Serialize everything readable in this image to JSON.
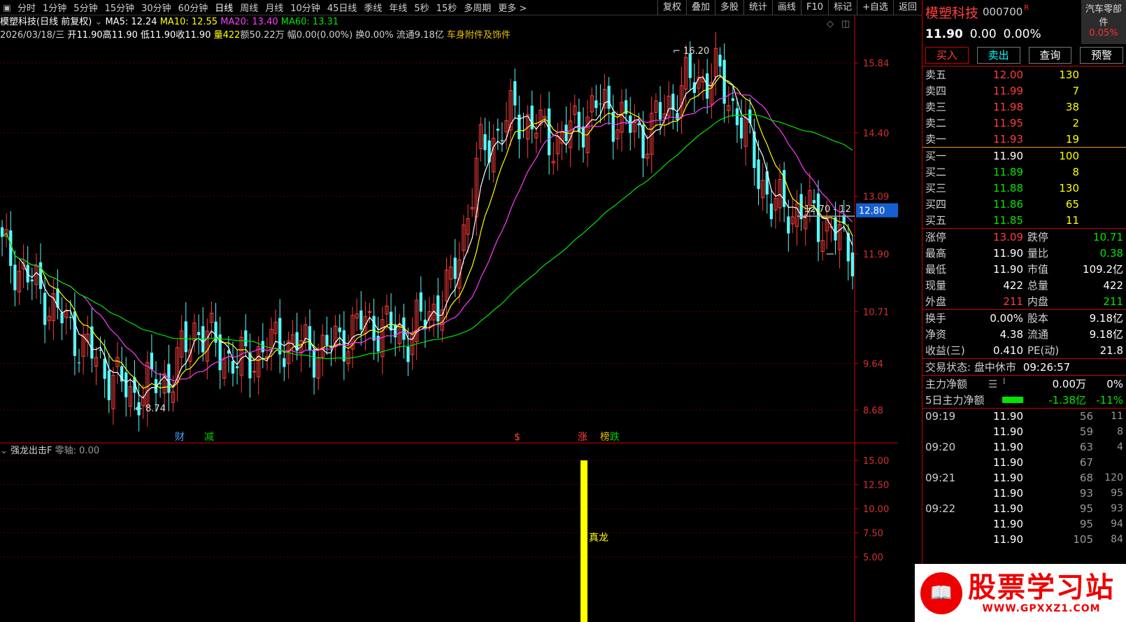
{
  "toolbar": {
    "periods": [
      "分时",
      "1分钟",
      "5分钟",
      "15分钟",
      "30分钟",
      "60分钟",
      "日线",
      "周线",
      "月线",
      "10分钟",
      "45日线",
      "季线",
      "年线",
      "5秒",
      "15秒",
      "多周期",
      "更多 >"
    ],
    "active_period": "日线",
    "buttons": [
      "复权",
      "叠加",
      "多股",
      "统计",
      "画线",
      "F10",
      "标记",
      "+自选",
      "返回"
    ]
  },
  "chart_header": {
    "title": "模塑科技(日线 前复权)",
    "ma5": "MA5: 12.24",
    "ma10": "MA10: 12.55",
    "ma20": "MA20: 13.40",
    "ma60": "MA60: 13.31",
    "date": "2026/03/18/三",
    "open": "开11.90",
    "high": "高11.90",
    "low": "低11.90",
    "close": "收11.90",
    "volume": "量422",
    "amount": "额50.22万",
    "change": "幅0.00(0.00%)",
    "turnover": "换0.00%",
    "float": "流通9.18亿",
    "concept": "车身附件及饰件"
  },
  "price_axis": [
    "15.84",
    "14.40",
    "13.09",
    "12.80",
    "11.90",
    "10.71",
    "9.64",
    "8.68"
  ],
  "annotations": {
    "high_marker": "16.20",
    "low_marker": "8.74",
    "line_label": "12.70 - 12",
    "current_price_tag": "12.80"
  },
  "event_tags": [
    "财",
    "减",
    "$",
    "涨",
    "榜",
    "跌"
  ],
  "indicator": {
    "name": "强龙出击F",
    "zero_axis": "零轴: 0.00",
    "axis": [
      "15.00",
      "12.50",
      "10.00",
      "7.50",
      "5.00"
    ],
    "signal_label": "真龙",
    "signal_value": 15
  },
  "colors": {
    "up": "#ff3c3c",
    "down": "#54ffff",
    "ma5": "#ffffff",
    "ma10": "#ffff00",
    "ma20": "#ff3cff",
    "ma60": "#00e600"
  },
  "quote": {
    "name": "模塑科技",
    "code": "000700",
    "r_flag": "R",
    "sector": "汽车零部件",
    "sector_change": "0.05%",
    "price": "11.90",
    "change": "0.00",
    "change_pct": "0.00%",
    "actions": [
      "买入",
      "卖出",
      "查询",
      "预警"
    ]
  },
  "order_book": {
    "asks": [
      {
        "label": "卖五",
        "price": "12.00",
        "vol": "130"
      },
      {
        "label": "卖四",
        "price": "11.99",
        "vol": "7"
      },
      {
        "label": "卖三",
        "price": "11.98",
        "vol": "38"
      },
      {
        "label": "卖二",
        "price": "11.95",
        "vol": "2"
      },
      {
        "label": "卖一",
        "price": "11.93",
        "vol": "19"
      }
    ],
    "bids": [
      {
        "label": "买一",
        "price": "11.90",
        "vol": "100"
      },
      {
        "label": "买二",
        "price": "11.89",
        "vol": "8"
      },
      {
        "label": "买三",
        "price": "11.88",
        "vol": "130"
      },
      {
        "label": "买四",
        "price": "11.86",
        "vol": "65"
      },
      {
        "label": "买五",
        "price": "11.85",
        "vol": "11"
      }
    ]
  },
  "stats": [
    {
      "l": "涨停",
      "v": "13.09",
      "l2": "跌停",
      "v2": "10.71"
    },
    {
      "l": "最高",
      "v": "11.90",
      "l2": "量比",
      "v2": "0.38"
    },
    {
      "l": "最低",
      "v": "11.90",
      "l2": "市值",
      "v2": "109.2亿"
    },
    {
      "l": "现量",
      "v": "422",
      "l2": "总量",
      "v2": "422"
    },
    {
      "l": "外盘",
      "v": "211",
      "l2": "内盘",
      "v2": "211"
    }
  ],
  "stats2": [
    {
      "l": "换手",
      "v": "0.00%",
      "l2": "股本",
      "v2": "9.18亿"
    },
    {
      "l": "净资",
      "v": "4.38",
      "l2": "流通",
      "v2": "9.18亿"
    },
    {
      "l": "收益(三)",
      "v": "0.410",
      "l2": "PE(动)",
      "v2": "21.8"
    }
  ],
  "trade_status": {
    "label": "交易状态: 盘中休市",
    "time": "09:26:57"
  },
  "fund_flow": [
    {
      "label": "主力净额",
      "value": "0.00万",
      "pct": "0%"
    },
    {
      "label": "5日主力净额",
      "value": "-1.38亿",
      "pct": "-11%"
    }
  ],
  "ticks": [
    {
      "t": "09:19",
      "p": "11.90",
      "v": "56",
      "n": "11"
    },
    {
      "t": "",
      "p": "11.90",
      "v": "59",
      "n": "8"
    },
    {
      "t": "09:20",
      "p": "11.90",
      "v": "63",
      "n": "4"
    },
    {
      "t": "",
      "p": "11.90",
      "v": "67",
      "n": ""
    },
    {
      "t": "09:21",
      "p": "11.90",
      "v": "68",
      "n": "120"
    },
    {
      "t": "",
      "p": "11.90",
      "v": "93",
      "n": "95"
    },
    {
      "t": "09:22",
      "p": "11.90",
      "v": "95",
      "n": "93"
    },
    {
      "t": "",
      "p": "11.90",
      "v": "95",
      "n": "94"
    },
    {
      "t": "",
      "p": "11.90",
      "v": "105",
      "n": "84"
    }
  ],
  "watermark": {
    "cn": "股票学习站",
    "url": "WWW.GPXXZ1.COM"
  }
}
